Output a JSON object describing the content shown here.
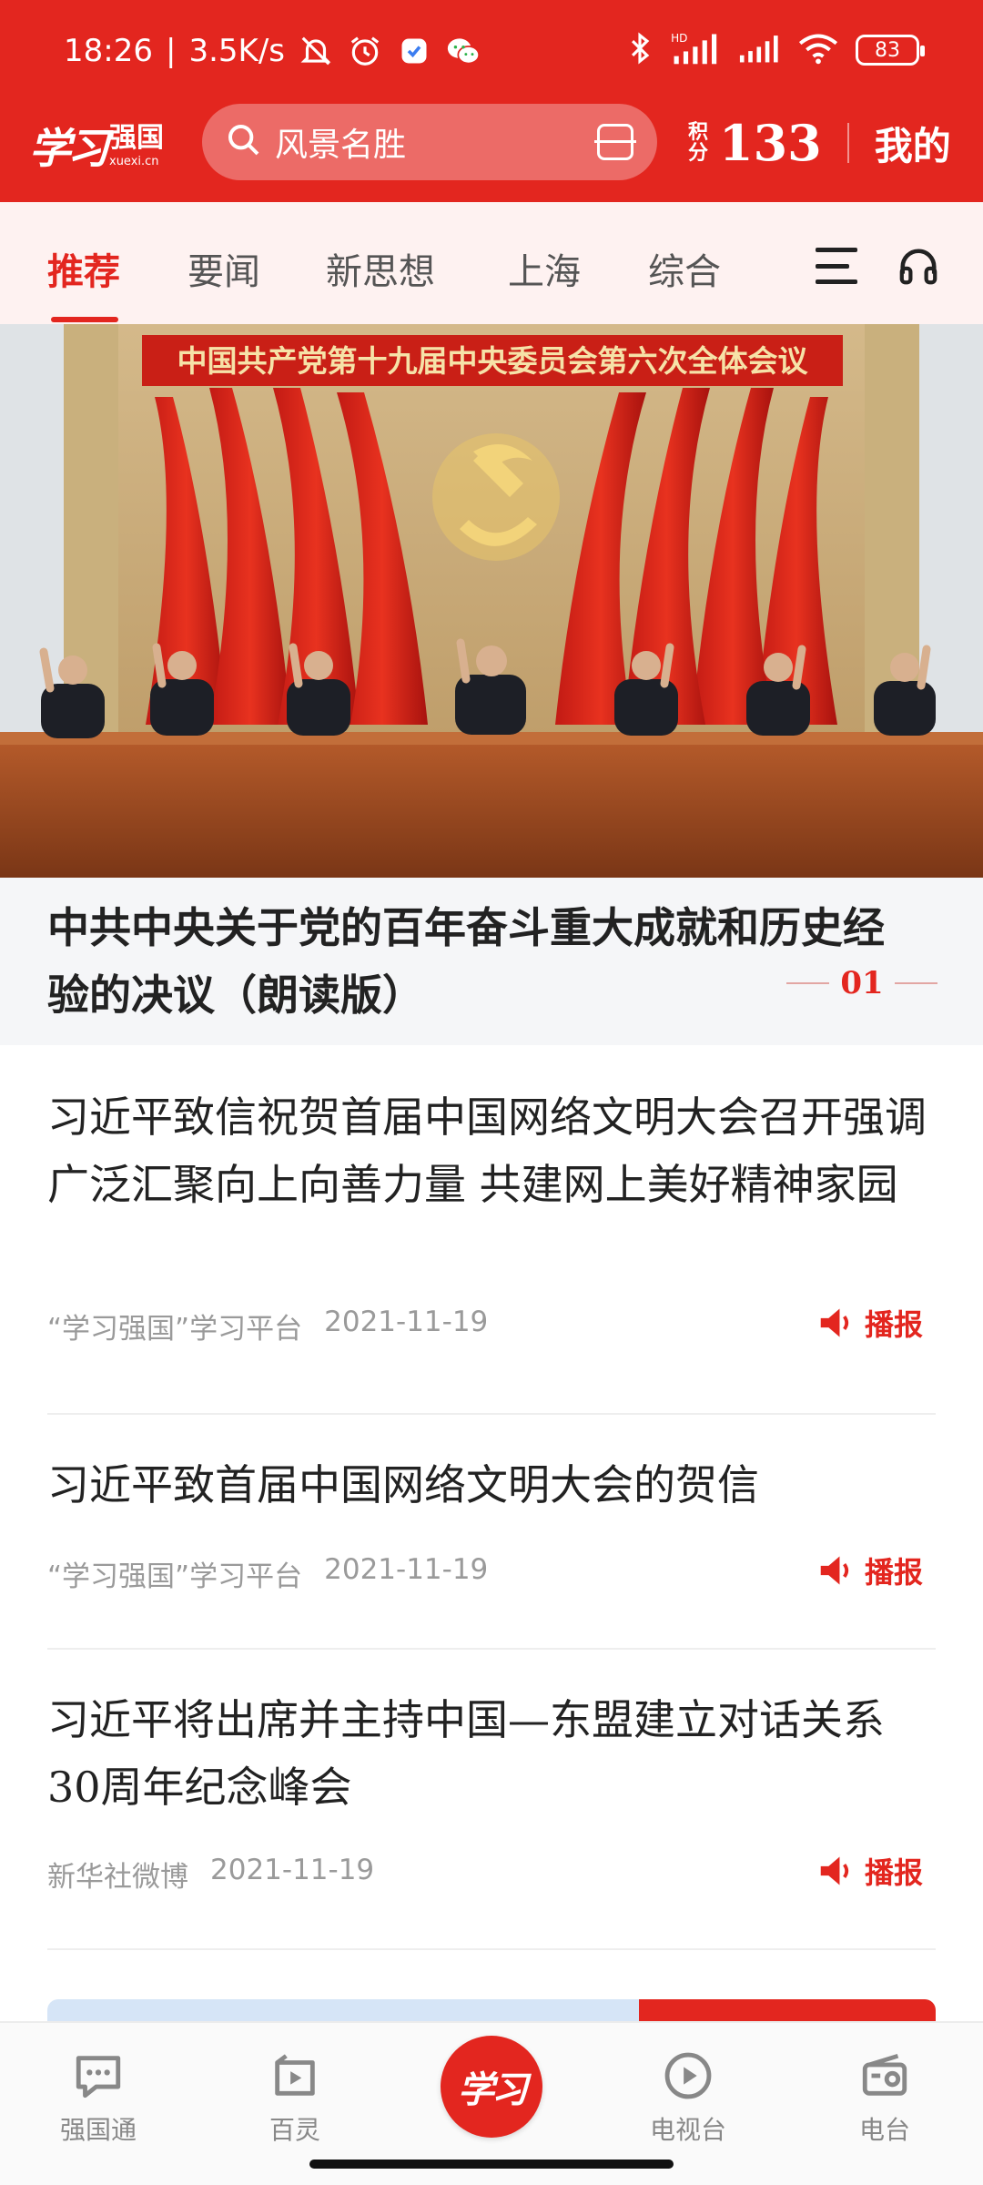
{
  "colors": {
    "brand_red": "#e3261f",
    "tab_bg": "#fef2f1",
    "caption_bg": "#f5f6f8",
    "meta_gray": "#9a9a9a"
  },
  "status_bar": {
    "time": "18:26",
    "network_speed": "3.5K/s",
    "battery": "83",
    "icons": [
      "mute-icon",
      "alarm-icon",
      "app-notification-icon",
      "wechat-icon",
      "bluetooth-icon",
      "signal-hd-icon",
      "signal-icon",
      "wifi-icon",
      "battery-icon"
    ]
  },
  "header": {
    "logo_script": "学习",
    "logo_cn": "强国",
    "logo_en": "xuexi.cn",
    "search_placeholder": "风景名胜",
    "points_label": "积分",
    "points_value": "133",
    "mine_label": "我的"
  },
  "tabs": {
    "items": [
      "推荐",
      "要闻",
      "新思想",
      "上海",
      "综合"
    ],
    "active_index": 0
  },
  "hero": {
    "banner_text": "中国共产党第十九届中央委员会第六次全体会议",
    "title": "中共中央关于党的百年奋斗重大成就和历史经验的决议（朗读版）",
    "index": "01"
  },
  "articles": [
    {
      "title": "习近平致信祝贺首届中国网络文明大会召开强调 广泛汇聚向上向善力量 共建网上美好精神家园",
      "source": "“学习强国”学习平台",
      "date": "2021-11-19",
      "action": "播报"
    },
    {
      "title": "习近平致首届中国网络文明大会的贺信",
      "source": "“学习强国”学习平台",
      "date": "2021-11-19",
      "action": "播报"
    },
    {
      "title": "习近平将出席并主持中国—东盟建立对话关系30周年纪念峰会",
      "source": "新华社微博",
      "date": "2021-11-19",
      "action": "播报"
    }
  ],
  "bottom_nav": {
    "items": [
      {
        "label": "强国通",
        "icon": "chat-icon"
      },
      {
        "label": "百灵",
        "icon": "video-icon"
      },
      {
        "label": "学习",
        "icon": "xuexi-logo"
      },
      {
        "label": "电视台",
        "icon": "play-circle-icon"
      },
      {
        "label": "电台",
        "icon": "radio-icon"
      }
    ]
  }
}
